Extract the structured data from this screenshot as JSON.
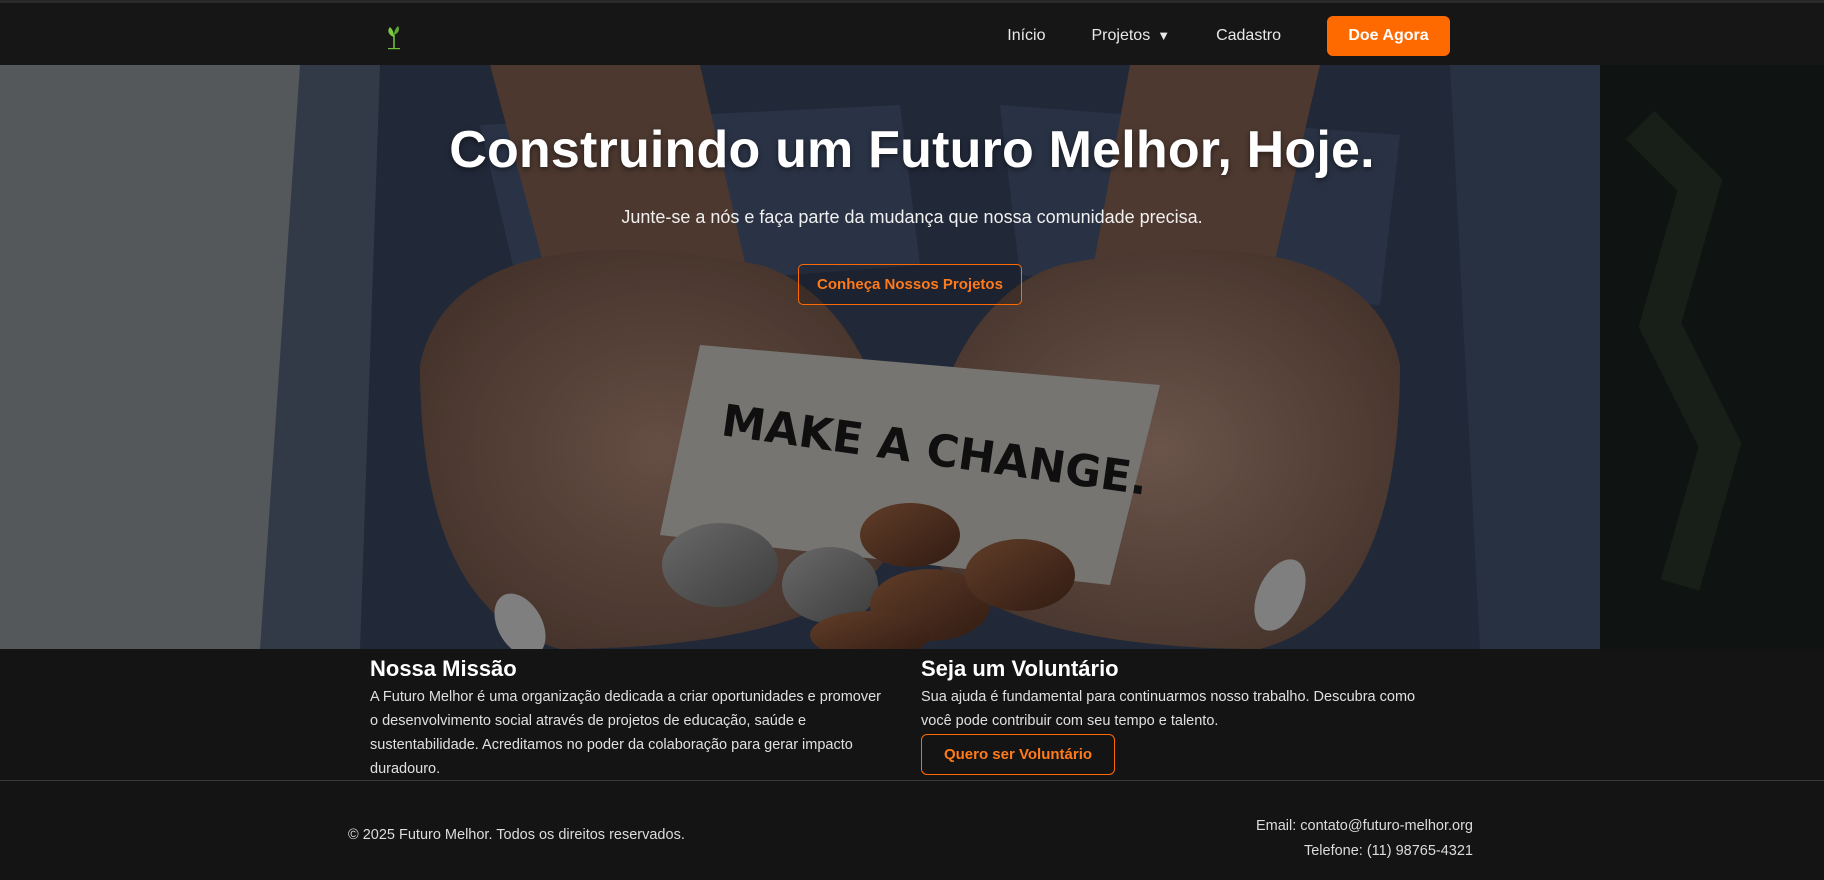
{
  "nav": {
    "logo_name": "sprout-logo-icon",
    "links": [
      {
        "label": "Início"
      },
      {
        "label": "Projetos",
        "caret": "▼"
      },
      {
        "label": "Cadastro"
      }
    ],
    "donate_label": "Doe Agora"
  },
  "hero": {
    "title": "Construindo um Futuro Melhor, Hoje.",
    "subtitle": "Junte-se a nós e faça parte da mudança que nossa comunidade precisa.",
    "cta_label": "Conheça Nossos Projetos",
    "image_text": "MAKE A CHANGE."
  },
  "mission": {
    "title": "Nossa Missão",
    "text": "A Futuro Melhor é uma organização dedicada a criar oportunidades e promover o desenvolvimento social através de projetos de educação, saúde e sustentabilidade. Acreditamos no poder da colaboração para gerar impacto duradouro."
  },
  "volunteer": {
    "title": "Seja um Voluntário",
    "text": "Sua ajuda é fundamental para continuarmos nosso trabalho. Descubra como você pode contribuir com seu tempo e talento.",
    "button_label": "Quero ser Voluntário"
  },
  "footer": {
    "copyright": "© 2025 Futuro Melhor. Todos os direitos reservados.",
    "email": "Email: contato@futuro-melhor.org",
    "phone": "Telefone: (11) 98765-4321"
  },
  "colors": {
    "accent": "#ff6a00",
    "background": "#141414",
    "nav_background": "#161616"
  }
}
